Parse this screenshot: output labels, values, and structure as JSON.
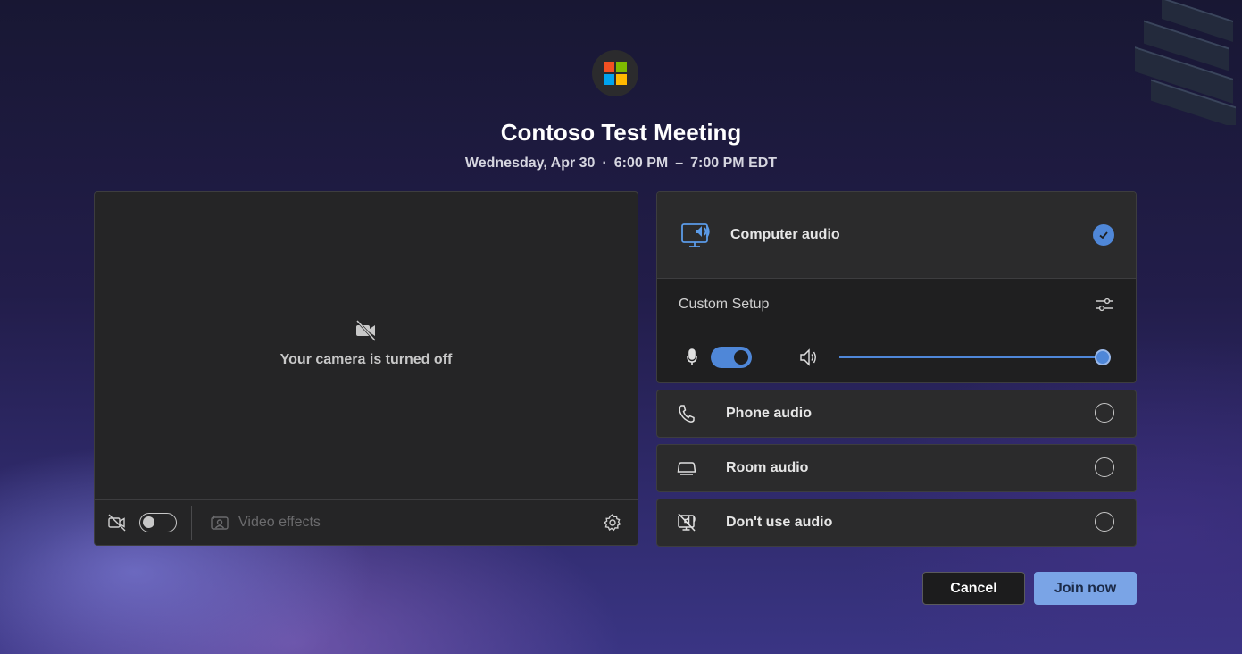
{
  "meeting": {
    "title": "Contoso Test Meeting",
    "date": "Wednesday, Apr 30",
    "start_time": "6:00 PM",
    "time_separator": "–",
    "end_time": "7:00 PM EDT",
    "dot": "·"
  },
  "video": {
    "camera_off_text": "Your camera is turned off",
    "camera_enabled": false,
    "video_effects_label": "Video effects"
  },
  "audio": {
    "computer_audio_label": "Computer audio",
    "computer_audio_selected": true,
    "custom_setup_label": "Custom Setup",
    "microphone_on": true,
    "speaker_volume_percent": 100,
    "options": [
      {
        "label": "Phone audio",
        "icon": "phone-icon",
        "selected": false
      },
      {
        "label": "Room audio",
        "icon": "room-device-icon",
        "selected": false
      },
      {
        "label": "Don't use audio",
        "icon": "no-audio-icon",
        "selected": false
      }
    ]
  },
  "buttons": {
    "cancel": "Cancel",
    "join": "Join now"
  },
  "colors": {
    "accent": "#4f87d8",
    "join_button": "#7aa4e6",
    "panel": "#2b2b2c",
    "ms_red": "#f25022",
    "ms_green": "#7fba00",
    "ms_blue": "#00a4ef",
    "ms_yellow": "#ffb900"
  }
}
